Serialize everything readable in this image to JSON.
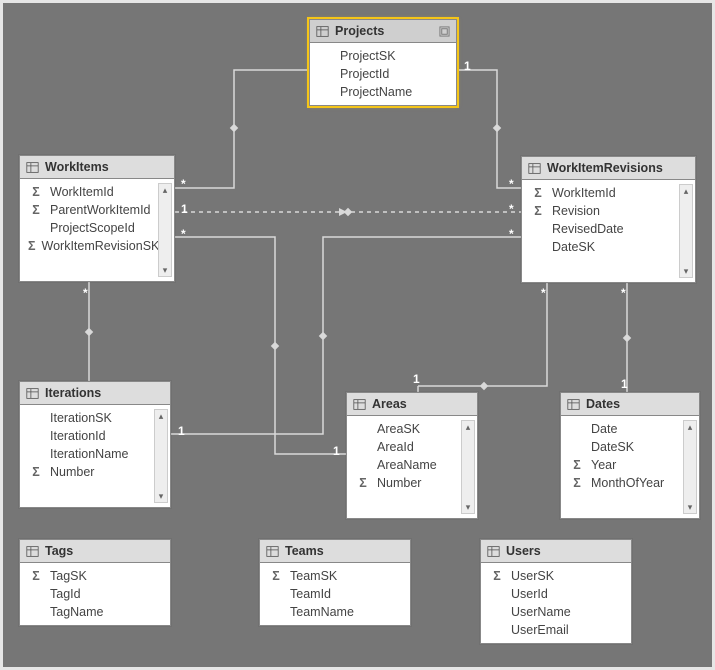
{
  "entities": {
    "projects": {
      "title": "Projects",
      "fields": [
        {
          "name": "ProjectSK",
          "sigma": false
        },
        {
          "name": "ProjectId",
          "sigma": false
        },
        {
          "name": "ProjectName",
          "sigma": false
        }
      ],
      "selected": true,
      "scrollbar": false
    },
    "workitems": {
      "title": "WorkItems",
      "fields": [
        {
          "name": "WorkItemId",
          "sigma": true
        },
        {
          "name": "ParentWorkItemId",
          "sigma": true
        },
        {
          "name": "ProjectScopeId",
          "sigma": false
        },
        {
          "name": "WorkItemRevisionSK",
          "sigma": true
        }
      ],
      "selected": false,
      "scrollbar": true
    },
    "workitemrevisions": {
      "title": "WorkItemRevisions",
      "fields": [
        {
          "name": "WorkItemId",
          "sigma": true
        },
        {
          "name": "Revision",
          "sigma": true
        },
        {
          "name": "RevisedDate",
          "sigma": false
        },
        {
          "name": "DateSK",
          "sigma": false
        }
      ],
      "selected": false,
      "scrollbar": true
    },
    "iterations": {
      "title": "Iterations",
      "fields": [
        {
          "name": "IterationSK",
          "sigma": false
        },
        {
          "name": "IterationId",
          "sigma": false
        },
        {
          "name": "IterationName",
          "sigma": false
        },
        {
          "name": "Number",
          "sigma": true
        }
      ],
      "selected": false,
      "scrollbar": true
    },
    "areas": {
      "title": "Areas",
      "fields": [
        {
          "name": "AreaSK",
          "sigma": false
        },
        {
          "name": "AreaId",
          "sigma": false
        },
        {
          "name": "AreaName",
          "sigma": false
        },
        {
          "name": "Number",
          "sigma": true
        }
      ],
      "selected": false,
      "scrollbar": true
    },
    "dates": {
      "title": "Dates",
      "fields": [
        {
          "name": "Date",
          "sigma": false
        },
        {
          "name": "DateSK",
          "sigma": false
        },
        {
          "name": "Year",
          "sigma": true
        },
        {
          "name": "MonthOfYear",
          "sigma": true
        }
      ],
      "selected": false,
      "scrollbar": true
    },
    "tags": {
      "title": "Tags",
      "fields": [
        {
          "name": "TagSK",
          "sigma": true
        },
        {
          "name": "TagId",
          "sigma": false
        },
        {
          "name": "TagName",
          "sigma": false
        }
      ],
      "selected": false,
      "scrollbar": false
    },
    "teams": {
      "title": "Teams",
      "fields": [
        {
          "name": "TeamSK",
          "sigma": true
        },
        {
          "name": "TeamId",
          "sigma": false
        },
        {
          "name": "TeamName",
          "sigma": false
        }
      ],
      "selected": false,
      "scrollbar": false
    },
    "users": {
      "title": "Users",
      "fields": [
        {
          "name": "UserSK",
          "sigma": true
        },
        {
          "name": "UserId",
          "sigma": false
        },
        {
          "name": "UserName",
          "sigma": false
        },
        {
          "name": "UserEmail",
          "sigma": false
        }
      ],
      "selected": false,
      "scrollbar": false
    }
  },
  "relationships": [
    {
      "from": "projects",
      "to": "workitems",
      "from_card": "1",
      "to_card": "*",
      "dashed": false
    },
    {
      "from": "projects",
      "to": "workitemrevisions",
      "from_card": "1",
      "to_card": "*",
      "dashed": false
    },
    {
      "from": "workitems",
      "to": "workitemrevisions",
      "from_card": "1",
      "to_card": "*",
      "dashed": true
    },
    {
      "from": "workitems",
      "to": "iterations",
      "from_card": "*",
      "to_card": "1",
      "dashed": false
    },
    {
      "from": "workitems",
      "to": "areas",
      "from_card": "*",
      "to_card": "1",
      "dashed": false
    },
    {
      "from": "workitemrevisions",
      "to": "iterations",
      "from_card": "*",
      "to_card": "1",
      "dashed": false
    },
    {
      "from": "workitemrevisions",
      "to": "areas",
      "from_card": "*",
      "to_card": "1",
      "dashed": false
    },
    {
      "from": "workitemrevisions",
      "to": "dates",
      "from_card": "*",
      "to_card": "1",
      "dashed": false
    }
  ],
  "icons": {
    "sigma_glyph": "Σ",
    "scroll_up": "▴",
    "scroll_down": "▾"
  }
}
